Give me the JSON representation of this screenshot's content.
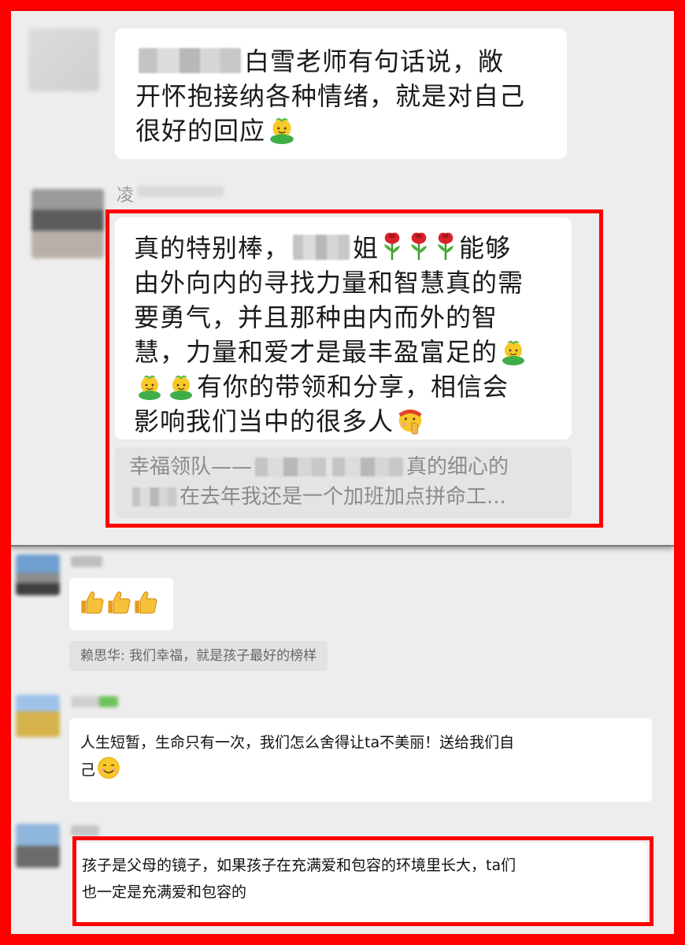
{
  "chat_top": {
    "message1": {
      "line1_after_mosaic": "白雪老师有句话说，敞",
      "line2": "开怀抱接纳各种情绪，就是对自己",
      "line3": "很好的回应"
    },
    "sender_initial": "凌",
    "message2": {
      "line1_before": "真的特别棒，",
      "line1_mid": "姐",
      "line1_after": "能够",
      "line2": "由外向内的寻找力量和智慧真的需",
      "line3": "要勇气，并且那种由内而外的智",
      "line4": "慧，力量和爱才是最丰盈富足的",
      "line5_after": "有你的带领和分享，相信会",
      "line6": "影响我们当中的很多人"
    },
    "quote": {
      "line1_before": "幸福领队——",
      "line1_after": "真的细心的",
      "line2_after": "在去年我还是一个加班加点拼命工..."
    }
  },
  "chat_bottom": {
    "thumbs_count": 3,
    "quote_reply": "赖思华: 我们幸福，就是孩子最好的榜样",
    "message_life": {
      "line1": "人生短暂，生命只有一次，我们怎么舍得让ta不美丽！送给我们自",
      "line2": "己"
    },
    "message_mirror": {
      "line1": "孩子是父母的镜子，如果孩子在充满爱和包容的环境里长大，ta们",
      "line2": "也一定是充满爱和包容的"
    }
  },
  "icons": [
    "avatar-blurred",
    "sprout-face-emoji",
    "rose-emoji",
    "shushing-face-emoji",
    "thumbs-up-emoji",
    "smiling-face-emoji"
  ],
  "colors": {
    "frame_red": "#ff0000",
    "chat_bg": "#ededed",
    "bubble_white": "#ffffff",
    "quote_gray": "#e4e4e4"
  }
}
